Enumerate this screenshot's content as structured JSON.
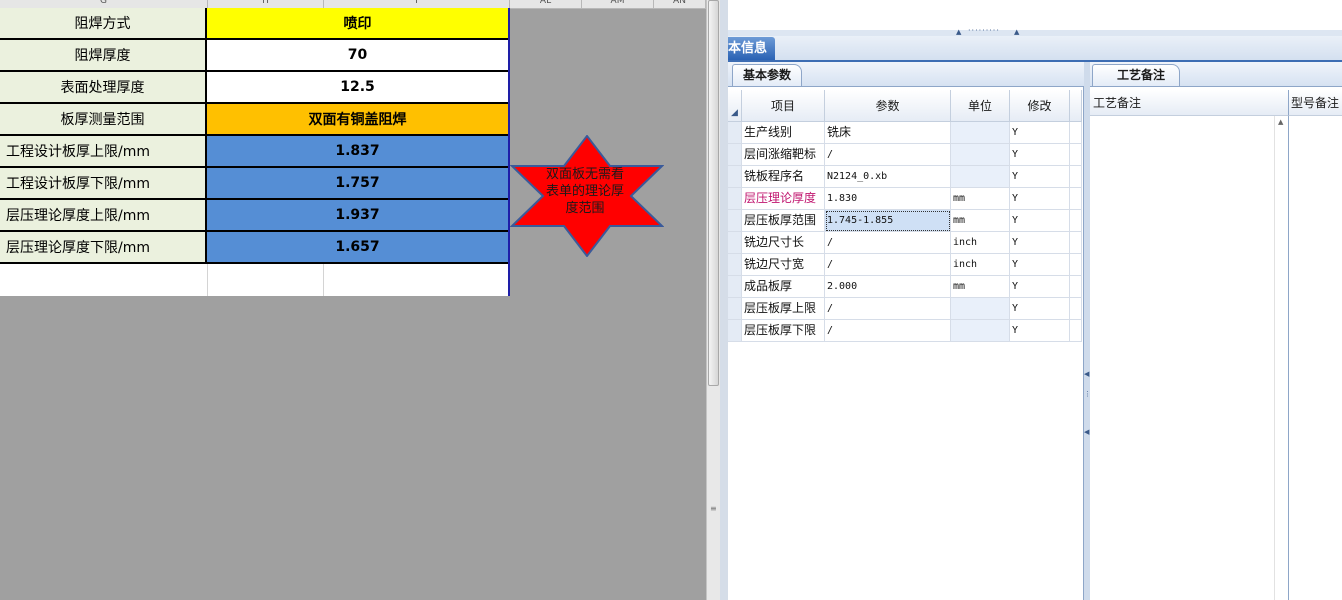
{
  "spreadsheet": {
    "column_headers": [
      "G",
      "H",
      "I",
      "AL",
      "AM",
      "AN"
    ],
    "rows": [
      {
        "label": "阻焊方式",
        "value": "喷印",
        "fill": "#ffff00"
      },
      {
        "label": "阻焊厚度",
        "value": "70",
        "fill": "#ffffff"
      },
      {
        "label": "表面处理厚度",
        "value": "12.5",
        "fill": "#ffffff"
      },
      {
        "label": "板厚测量范围",
        "value": "双面有铜盖阻焊",
        "fill": "#ffc000"
      },
      {
        "label": "工程设计板厚上限/mm",
        "value": "1.837",
        "fill": "#558ed5"
      },
      {
        "label": "工程设计板厚下限/mm",
        "value": "1.757",
        "fill": "#558ed5"
      },
      {
        "label": "层压理论厚度上限/mm",
        "value": "1.937",
        "fill": "#558ed5"
      },
      {
        "label": "层压理论厚度下限/mm",
        "value": "1.657",
        "fill": "#558ed5"
      }
    ],
    "callout": "双面板无需看表单的理论厚度范围"
  },
  "panel": {
    "main_tab": "本信息",
    "left_tab": "基本参数",
    "right_tab": "工艺备注",
    "table_headers": [
      "项目",
      "参数",
      "单位",
      "修改"
    ],
    "table_rows": [
      {
        "item": "生产线别",
        "param": "铣床",
        "unit": "",
        "edit": "Y"
      },
      {
        "item": "层间涨缩靶标",
        "param": "/",
        "unit": "",
        "edit": "Y"
      },
      {
        "item": "铣板程序名",
        "param": "N2124_0.xb",
        "unit": "",
        "edit": "Y"
      },
      {
        "item": "层压理论厚度",
        "param": "1.830",
        "unit": "mm",
        "edit": "Y"
      },
      {
        "item": "层压板厚范围",
        "param": "1.745-1.855",
        "unit": "mm",
        "edit": "Y"
      },
      {
        "item": "铣边尺寸长",
        "param": "/",
        "unit": "inch",
        "edit": "Y"
      },
      {
        "item": "铣边尺寸宽",
        "param": "/",
        "unit": "inch",
        "edit": "Y"
      },
      {
        "item": "成品板厚",
        "param": "2.000",
        "unit": "mm",
        "edit": "Y"
      },
      {
        "item": "层压板厚上限",
        "param": "/",
        "unit": "",
        "edit": "Y"
      },
      {
        "item": "层压板厚下限",
        "param": "/",
        "unit": "",
        "edit": "Y"
      }
    ],
    "notes_header": "工艺备注",
    "model_header": "型号备注"
  },
  "colors": {
    "label_bg": "#ebf1de",
    "grid_border": "#1e1ea8",
    "star_fill": "#ff0000",
    "star_stroke": "#3a5a9a",
    "tab_blue": "#2a62b4",
    "highlight_item": "#c0146e"
  }
}
